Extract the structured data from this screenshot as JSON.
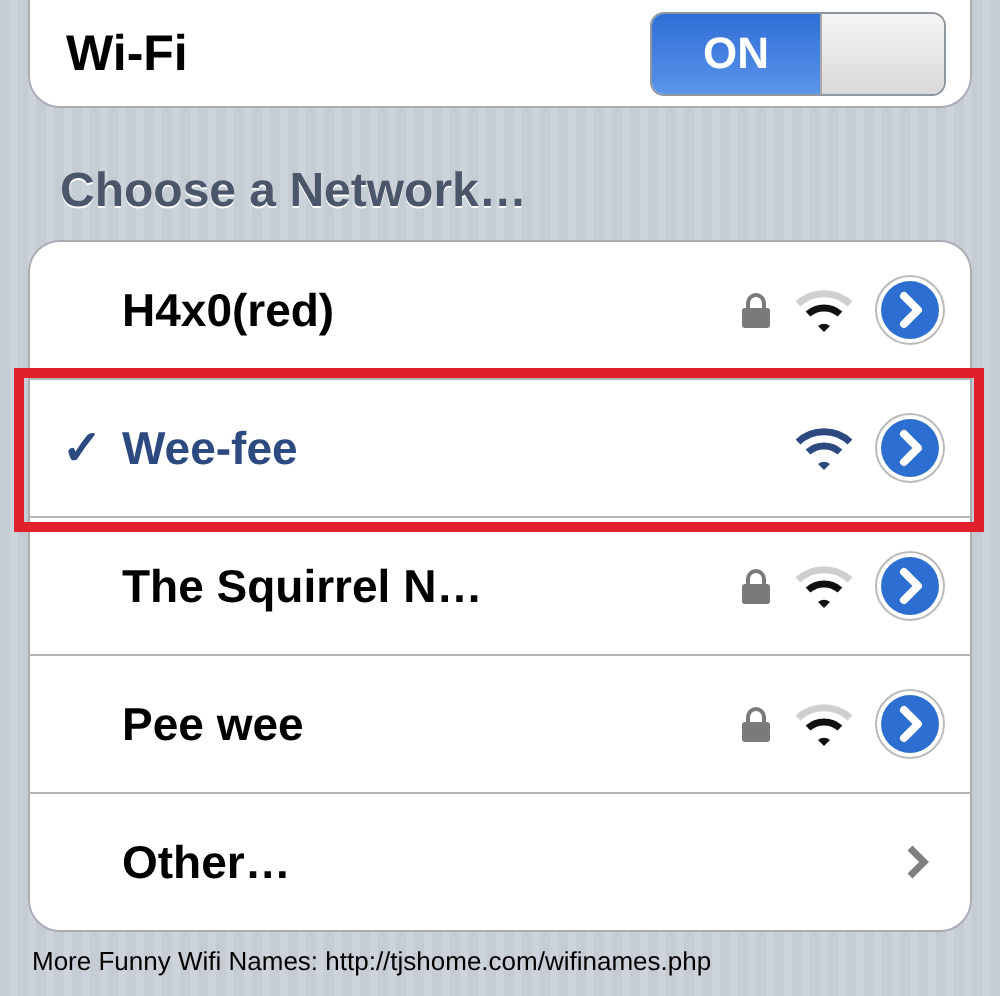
{
  "wifi": {
    "label": "Wi-Fi",
    "toggle": {
      "on": true,
      "label": "ON"
    }
  },
  "section_header": "Choose a Network…",
  "networks": [
    {
      "kind": "network",
      "name": "H4x0(red)",
      "selected": false,
      "locked": true,
      "highlighted": false
    },
    {
      "kind": "network",
      "name": "Wee-fee",
      "selected": true,
      "locked": false,
      "highlighted": true,
      "check": "✓"
    },
    {
      "kind": "network",
      "name": "The Squirrel N…",
      "selected": false,
      "locked": true,
      "highlighted": false
    },
    {
      "kind": "network",
      "name": "Pee wee",
      "selected": false,
      "locked": true,
      "highlighted": false
    },
    {
      "kind": "other",
      "name": "Other…"
    }
  ],
  "caption": "More Funny Wifi Names: http://tjshome.com/wifinames.php"
}
